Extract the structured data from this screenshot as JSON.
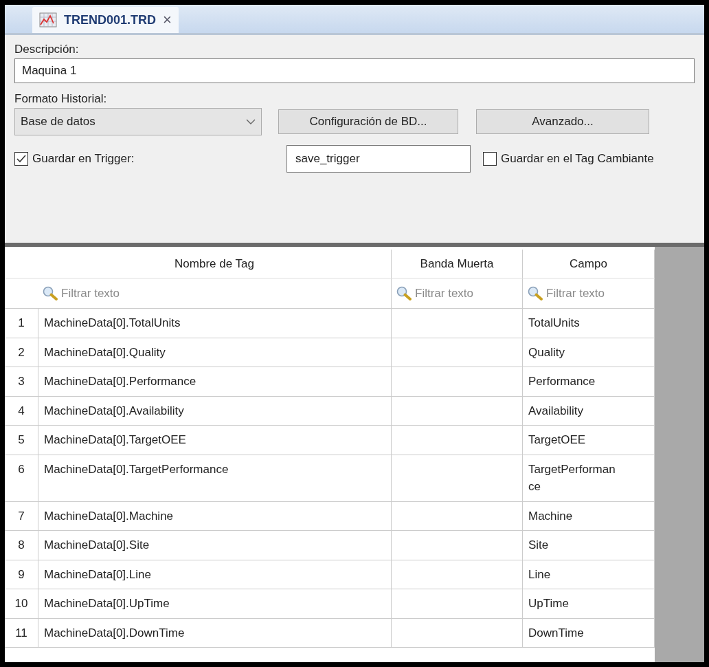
{
  "tab": {
    "title": "TREND001.TRD",
    "close": "×"
  },
  "form": {
    "description_label": "Descripción:",
    "description_value": "Maquina 1",
    "format_label": "Formato  Historial:",
    "format_value": "Base de datos",
    "db_button": "Configuración de BD...",
    "advanced_button": "Avanzado...",
    "trigger": {
      "label": "Guardar en Trigger:",
      "checked": true,
      "value": "save_trigger"
    },
    "on_change": {
      "label": "Guardar en el Tag Cambiante",
      "checked": false
    }
  },
  "table": {
    "columns": [
      {
        "label": "Nombre de Tag",
        "filter_placeholder": "Filtrar texto"
      },
      {
        "label": "Banda Muerta",
        "filter_placeholder": "Filtrar texto"
      },
      {
        "label": "Campo",
        "filter_placeholder": "Filtrar texto"
      }
    ],
    "rows": [
      {
        "n": "1",
        "tag": "MachineData[0].TotalUnits",
        "field": "TotalUnits"
      },
      {
        "n": "2",
        "tag": "MachineData[0].Quality",
        "field": "Quality"
      },
      {
        "n": "3",
        "tag": "MachineData[0].Performance",
        "field": "Performance"
      },
      {
        "n": "4",
        "tag": "MachineData[0].Availability",
        "field": "Availability"
      },
      {
        "n": "5",
        "tag": "MachineData[0].TargetOEE",
        "field": "TargetOEE"
      },
      {
        "n": "6",
        "tag": "MachineData[0].TargetPerformance",
        "field": "TargetPerformance"
      },
      {
        "n": "7",
        "tag": "MachineData[0].Machine",
        "field": "Machine"
      },
      {
        "n": "8",
        "tag": "MachineData[0].Site",
        "field": "Site"
      },
      {
        "n": "9",
        "tag": "MachineData[0].Line",
        "field": "Line"
      },
      {
        "n": "10",
        "tag": "MachineData[0].UpTime",
        "field": "UpTime"
      },
      {
        "n": "11",
        "tag": "MachineData[0].DownTime",
        "field": "DownTime"
      }
    ]
  }
}
